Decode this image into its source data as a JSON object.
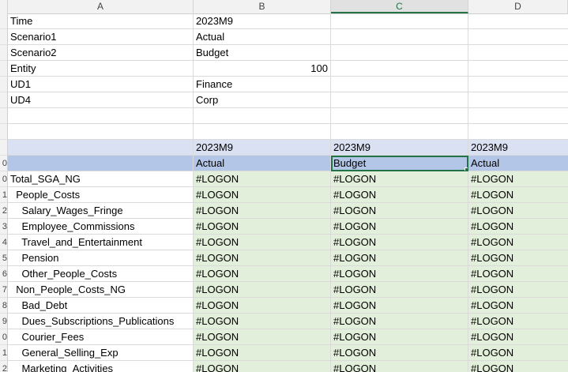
{
  "columns": [
    "A",
    "B",
    "C",
    "D"
  ],
  "active_column": "C",
  "row_numbers": [
    "",
    "",
    "",
    "",
    "",
    "",
    "",
    "",
    "",
    "0",
    "0",
    "1",
    "2",
    "3",
    "4",
    "5",
    "6",
    "7",
    "8",
    "9",
    "0",
    "1",
    "2",
    ""
  ],
  "pov": [
    {
      "label": "Time",
      "value": "2023M9"
    },
    {
      "label": "Scenario1",
      "value": "Actual"
    },
    {
      "label": "Scenario2",
      "value": "Budget"
    },
    {
      "label": "Entity",
      "value": "100"
    },
    {
      "label": "UD1",
      "value": "Finance"
    },
    {
      "label": "UD4",
      "value": "Corp"
    }
  ],
  "grid_header": {
    "periods": [
      "2023M9",
      "2023M9",
      "2023M9"
    ],
    "scenarios": [
      "Actual",
      "Budget",
      "Actual"
    ]
  },
  "accounts": [
    {
      "name": "Total_SGA_NG",
      "values": [
        "#LOGON",
        "#LOGON",
        "#LOGON"
      ]
    },
    {
      "name": "  People_Costs",
      "values": [
        "#LOGON",
        "#LOGON",
        "#LOGON"
      ]
    },
    {
      "name": "    Salary_Wages_Fringe",
      "values": [
        "#LOGON",
        "#LOGON",
        "#LOGON"
      ]
    },
    {
      "name": "    Employee_Commissions",
      "values": [
        "#LOGON",
        "#LOGON",
        "#LOGON"
      ]
    },
    {
      "name": "    Travel_and_Entertainment",
      "values": [
        "#LOGON",
        "#LOGON",
        "#LOGON"
      ]
    },
    {
      "name": "    Pension",
      "values": [
        "#LOGON",
        "#LOGON",
        "#LOGON"
      ]
    },
    {
      "name": "    Other_People_Costs",
      "values": [
        "#LOGON",
        "#LOGON",
        "#LOGON"
      ]
    },
    {
      "name": "  Non_People_Costs_NG",
      "values": [
        "#LOGON",
        "#LOGON",
        "#LOGON"
      ]
    },
    {
      "name": "    Bad_Debt",
      "values": [
        "#LOGON",
        "#LOGON",
        "#LOGON"
      ]
    },
    {
      "name": "    Dues_Subscriptions_Publications",
      "values": [
        "#LOGON",
        "#LOGON",
        "#LOGON"
      ]
    },
    {
      "name": "    Courier_Fees",
      "values": [
        "#LOGON",
        "#LOGON",
        "#LOGON"
      ]
    },
    {
      "name": "    General_Selling_Exp",
      "values": [
        "#LOGON",
        "#LOGON",
        "#LOGON"
      ]
    },
    {
      "name": "    Marketing_Activities",
      "values": [
        "#LOGON",
        "#LOGON",
        "#LOGON"
      ]
    }
  ],
  "colors": {
    "header_band": "#d9e1f2",
    "scenario_band": "#b4c6e7",
    "data_fill": "#e2efda",
    "selection": "#217346"
  }
}
